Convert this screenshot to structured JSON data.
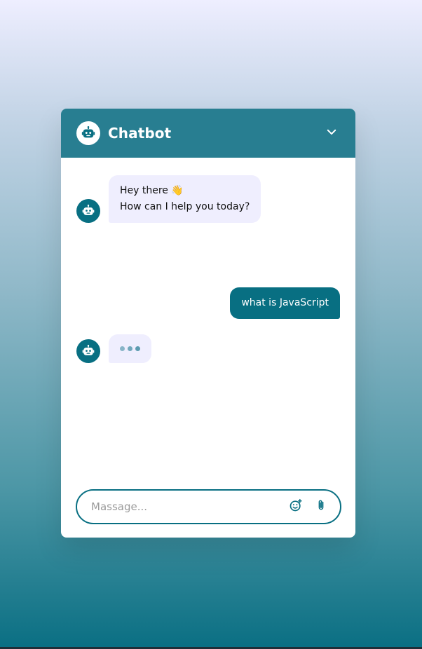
{
  "header": {
    "title": "Chatbot"
  },
  "messages": {
    "bot_greeting_line1": "Hey there 👋",
    "bot_greeting_line2": "How can I help you today?",
    "user_message": "what is JavaScript"
  },
  "footer": {
    "input_placeholder": "Massage...",
    "input_value": ""
  },
  "icons": {
    "header_logo": "robot-icon",
    "collapse": "chevron-down-icon",
    "bot_avatar": "robot-icon",
    "emoji": "emoji-smile-icon",
    "attach": "paperclip-icon"
  },
  "colors": {
    "header_bg": "#287e91",
    "accent": "#086f82",
    "bot_bubble_bg": "#efeefe",
    "user_bubble_bg": "#086f82"
  }
}
